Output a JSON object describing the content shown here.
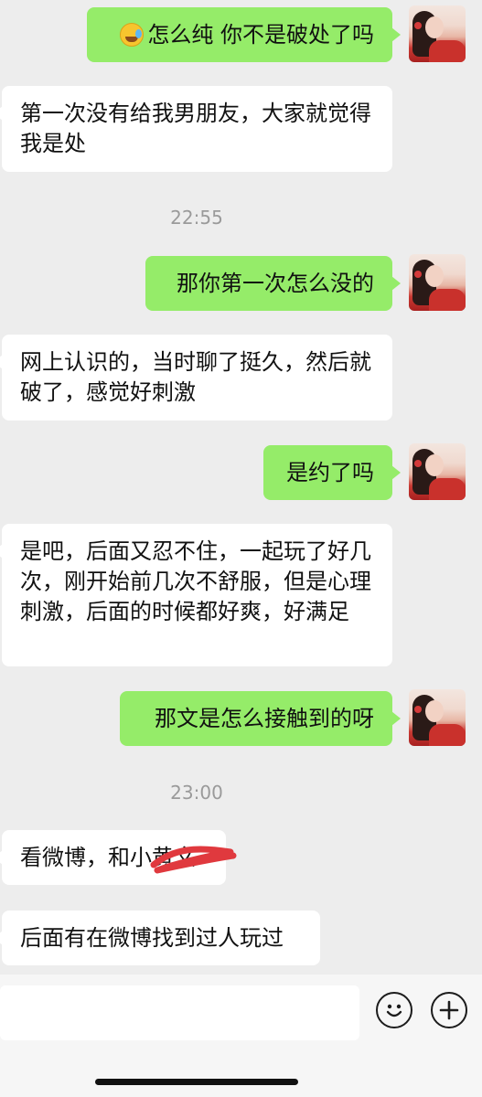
{
  "messages": [
    {
      "side": "right",
      "text": "怎么纯 你不是破处了吗",
      "has_emoji": true,
      "emoji": "face-with-tears-icon"
    },
    {
      "side": "left",
      "text": "第一次没有给我男朋友，大家就觉得我是处"
    },
    {
      "type": "time",
      "text": "22:55"
    },
    {
      "side": "right",
      "text": "那你第一次怎么没的"
    },
    {
      "side": "left",
      "text": "网上认识的，当时聊了挺久，然后就破了，感觉好刺激"
    },
    {
      "side": "right",
      "text": "是约了吗"
    },
    {
      "side": "left",
      "text": "是吧，后面又忍不住，一起玩了好几次，刚开始前几次不舒服，但是心理刺激，后面的时候都好爽，好满足"
    },
    {
      "side": "right",
      "text": "那文是怎么接触到的呀"
    },
    {
      "type": "time",
      "text": "23:00"
    },
    {
      "side": "left",
      "text": "看微博，和小黄文"
    },
    {
      "side": "left",
      "text": "后面有在微博找到过人玩过"
    }
  ],
  "colors": {
    "outgoing_bubble": "#95ec69",
    "incoming_bubble": "#ffffff",
    "background": "#ededed",
    "scribble": "#e0393e"
  },
  "input_bar": {
    "emoji_button": "smiley-icon",
    "add_button": "plus-icon"
  }
}
